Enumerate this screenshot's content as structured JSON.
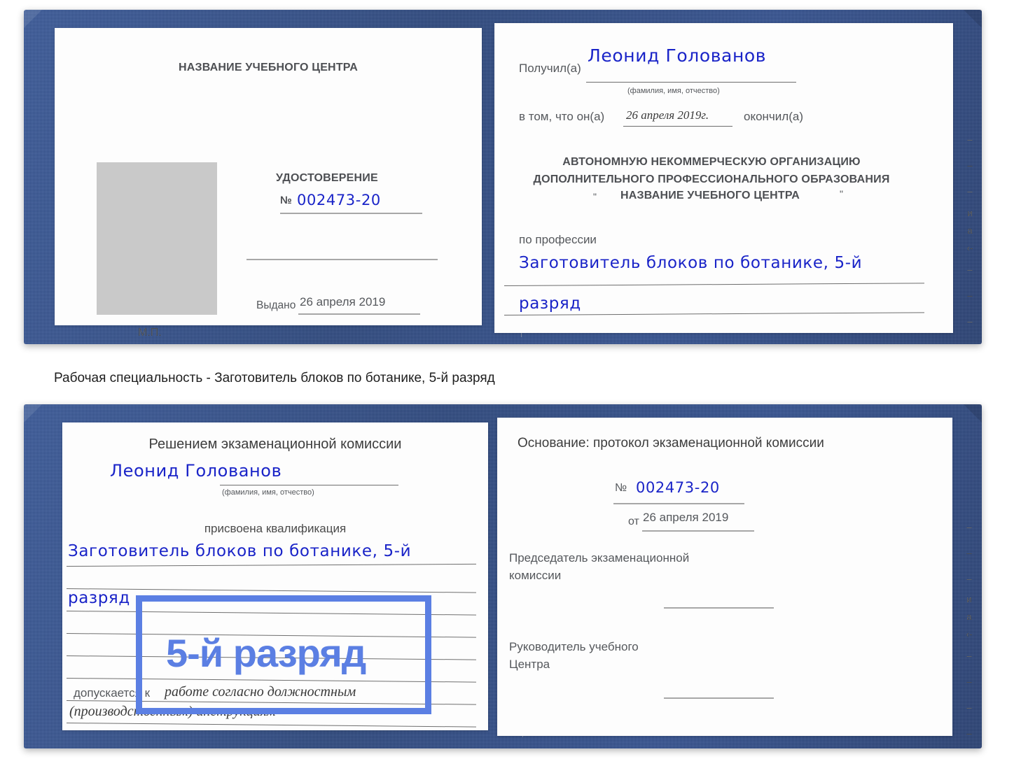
{
  "document": {
    "type": "Удостоверение",
    "caption": "Рабочая специальность - Заготовитель блоков по ботанике, 5-й разряд",
    "accent_color": "#5b7fe3",
    "cover_color": "#2d4d8e",
    "handwriting_color": "#1a24c8"
  },
  "top_spread": {
    "left_page": {
      "center_name": "НАЗВАНИЕ УЧЕБНОГО ЦЕНТРА",
      "title": "УДОСТОВЕРЕНИЕ",
      "number_label": "№",
      "number_value": "002473-20",
      "issued_label": "Выдано",
      "issued_value": "26 апреля 2019",
      "seal_label": "М.П.",
      "photo_placeholder": "photo-placeholder"
    },
    "right_page": {
      "received_label": "Получил(а)",
      "received_value": "Леонид Голованов",
      "received_hint": "(фамилия, имя, отчество)",
      "that_he_label": "в том, что он(а)",
      "that_he_value": "26 апреля 2019г.",
      "finished_label": "окончил(а)",
      "org_line1": "АВТОНОМНУЮ НЕКОММЕРЧЕСКУЮ ОРГАНИЗАЦИЮ",
      "org_line2": "ДОПОЛНИТЕЛЬНОГО ПРОФЕССИОНАЛЬНОГО ОБРАЗОВАНИЯ",
      "org_quote_open": "\"",
      "org_name": "НАЗВАНИЕ УЧЕБНОГО ЦЕНТРА",
      "org_quote_close": "\"",
      "profession_label": "по профессии",
      "profession_line1": "Заготовитель блоков по ботанике, 5-й",
      "profession_line2": "разряд",
      "stub_marks": [
        "–",
        "–",
        "–",
        "и",
        "а",
        "‹-",
        "–",
        "–",
        "–"
      ]
    }
  },
  "bottom_spread": {
    "left_page": {
      "decision_title": "Решением экзаменационной комиссии",
      "name_value": "Леонид Голованов",
      "name_hint": "(фамилия, имя, отчество)",
      "qualification_label": "присвоена квалификация",
      "qualification_line1": "Заготовитель блоков по ботанике, 5-й",
      "qualification_line2": "разряд",
      "admitted_label": "допускается к",
      "admitted_value_line1": "работе согласно должностным",
      "admitted_value_line2": "(производственным) инструкциям",
      "highlight_text": "5-й разряд"
    },
    "right_page": {
      "basis_label": "Основание: протокол экзаменационной комиссии",
      "number_label": "№",
      "number_value": "002473-20",
      "date_label": "от",
      "date_value": "26 апреля 2019",
      "chairman_line1": "Председатель экзаменационной",
      "chairman_line2": "комиссии",
      "head_line1": "Руководитель учебного",
      "head_line2": "Центра",
      "stub_marks": [
        "–",
        "–",
        "–",
        "и",
        "а",
        "‹-",
        "–",
        "–",
        "–",
        "–"
      ]
    }
  }
}
